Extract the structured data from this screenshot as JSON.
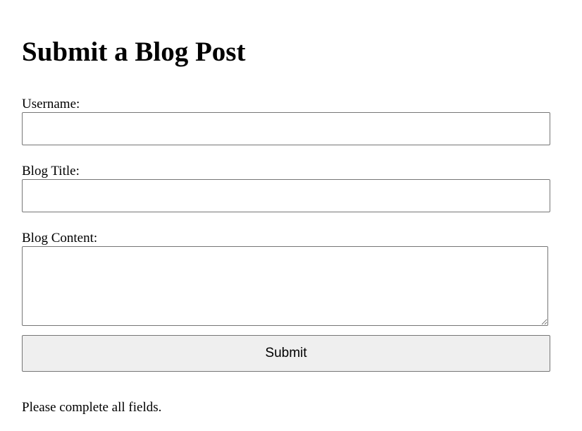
{
  "page": {
    "title": "Submit a Blog Post"
  },
  "form": {
    "username": {
      "label": "Username:",
      "value": ""
    },
    "blog_title": {
      "label": "Blog Title:",
      "value": ""
    },
    "blog_content": {
      "label": "Blog Content:",
      "value": ""
    },
    "submit_label": "Submit"
  },
  "status_message": "Please complete all fields."
}
